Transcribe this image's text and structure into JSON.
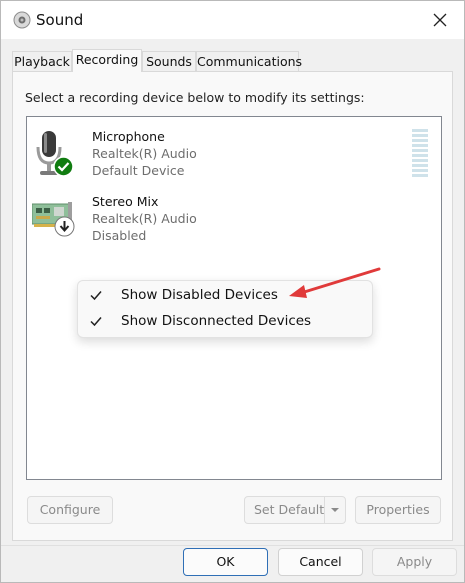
{
  "window": {
    "title": "Sound"
  },
  "tabs": [
    {
      "label": "Playback"
    },
    {
      "label": "Recording"
    },
    {
      "label": "Sounds"
    },
    {
      "label": "Communications"
    }
  ],
  "active_tab": "Recording",
  "instruction": "Select a recording device below to modify its settings:",
  "devices": [
    {
      "name": "Microphone",
      "driver": "Realtek(R) Audio",
      "status": "Default Device",
      "icon": "microphone-icon",
      "badge": "check-badge-icon",
      "badge_color": "#107c10"
    },
    {
      "name": "Stereo Mix",
      "driver": "Realtek(R) Audio",
      "status": "Disabled",
      "icon": "sound-card-icon",
      "badge": "disabled-arrow-badge-icon"
    }
  ],
  "context_menu": {
    "items": [
      {
        "label": "Show Disabled Devices",
        "checked": true
      },
      {
        "label": "Show Disconnected Devices",
        "checked": true
      }
    ]
  },
  "annotation": {
    "type": "red-arrow",
    "color": "#e03a3a",
    "points_to": "Show Disabled Devices"
  },
  "panel_buttons": {
    "configure": "Configure",
    "set_default": "Set Default",
    "properties": "Properties"
  },
  "dialog_buttons": {
    "ok": "OK",
    "cancel": "Cancel",
    "apply": "Apply"
  },
  "colors": {
    "accent": "#2f6fb6",
    "level_meter": "#cfe2ea",
    "arrow": "#e03a3a"
  }
}
